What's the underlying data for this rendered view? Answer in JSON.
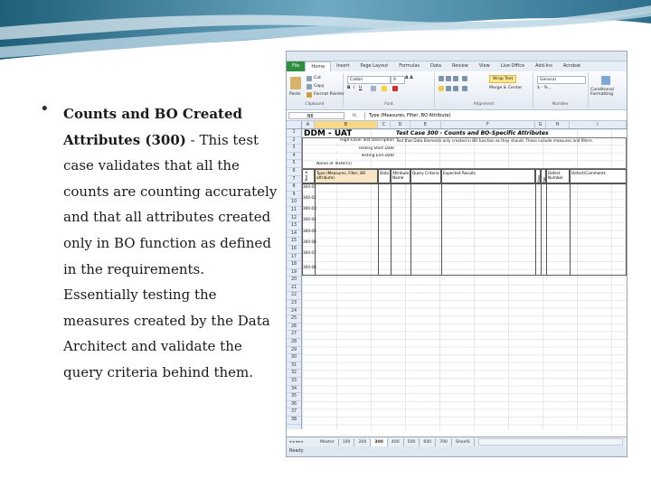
{
  "slide": {
    "bullet": "•",
    "lines": [
      {
        "text": "Counts and BO Created",
        "bold": true
      },
      {
        "text": "Attributes (300)",
        "bold": true,
        "rest": " - This test"
      },
      {
        "text": "case validates that all the"
      },
      {
        "text": "counts are counting accurately"
      },
      {
        "text": "and that all attributes created"
      },
      {
        "text": "only in BO function as defined"
      },
      {
        "text": "in the requirements."
      },
      {
        "text": "Essentially testing the"
      },
      {
        "text": "measures created by the Data"
      },
      {
        "text": "Architect and validate the"
      },
      {
        "text": "query criteria behind them."
      }
    ]
  },
  "excel": {
    "tabs": {
      "file": "File",
      "items": [
        "Home",
        "Insert",
        "Page Layout",
        "Formulas",
        "Data",
        "Review",
        "View",
        "Live Office",
        "Add-Ins",
        "Acrobat"
      ]
    },
    "ribbon": {
      "paste": "Paste",
      "cut": "Cut",
      "copy": "Copy",
      "format_painter": "Format Painter",
      "clipboard": "Clipboard",
      "font_name": "Calibri",
      "font_size": "9",
      "font": "Font",
      "wrap_text": "Wrap Text",
      "merge_center": "Merge & Center",
      "alignment": "Alignment",
      "number_format": "General",
      "number": "Number",
      "conditional": "Conditional Formatting"
    },
    "formula_bar": {
      "name_box": "B6",
      "fx": "fx",
      "content": "Type (Measures, Filter, BO Attribute)"
    },
    "columns": [
      "A",
      "B",
      "C",
      "D",
      "E",
      "F",
      "G",
      "H",
      "I"
    ],
    "rows": [
      "1",
      "2",
      "3",
      "4",
      "5",
      "6",
      "7",
      "8",
      "9",
      "10",
      "11",
      "12",
      "13",
      "14",
      "15",
      "16",
      "17",
      "18",
      "19",
      "20",
      "21",
      "22",
      "23",
      "24",
      "25",
      "26",
      "27",
      "28",
      "29",
      "30",
      "31",
      "32",
      "33",
      "34",
      "35",
      "36",
      "37",
      "38"
    ],
    "sheet": {
      "title": "DDM - UAT",
      "case_title": "Test Case 300 - Counts and BO-Specific Attributes",
      "label_desc": "High-Level Test Description",
      "desc": "Test that Data Elements only created in BO function as they should. These include measures and filters.",
      "label_start": "Testing Start Date",
      "label_end": "Testing End Date",
      "label_tester": "Name of Tester(s)",
      "headers": [
        "Type (Measures, Filter, BO attribute)",
        "Data",
        "Attribute Name",
        "Query Criteria",
        "Expected Results",
        "Pass",
        "Fail",
        "Defect Number",
        "Defect/Comments"
      ],
      "ids": [
        "300-01",
        "300-02",
        "300-03",
        "300-04",
        "300-05",
        "300-06",
        "300-07",
        "300-08"
      ],
      "vertical_a": "Test #"
    },
    "sheet_tabs": [
      "Master",
      "100",
      "200",
      "300",
      "400",
      "500",
      "600",
      "700",
      "Sheet1"
    ],
    "active_sheet": "300",
    "status": "Ready"
  }
}
